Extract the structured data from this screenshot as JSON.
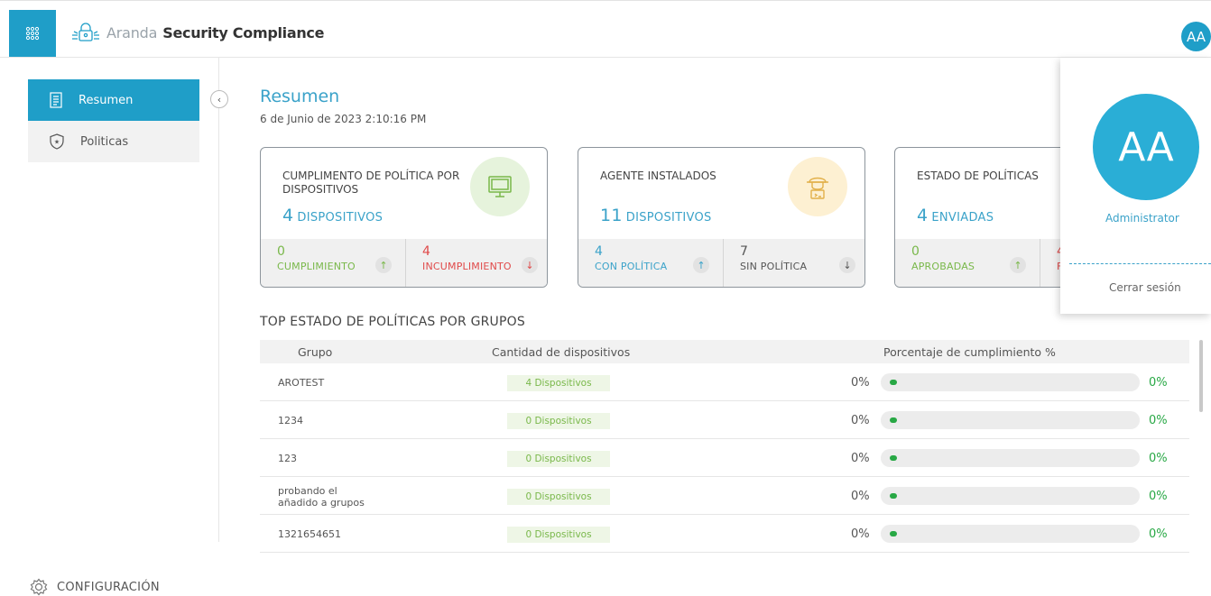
{
  "header": {
    "app_name_light": "Aranda",
    "app_name_bold": "Security Compliance",
    "avatar_initials": "AA",
    "icons": [
      "apps-grid-icon",
      "aranda-logo-icon"
    ],
    "accent": "#1f9ec8"
  },
  "sidebar": {
    "items": [
      {
        "label": "Resumen",
        "icon": "document-icon",
        "active": true
      },
      {
        "label": "Politicas",
        "icon": "shield-star-icon",
        "active": false
      }
    ],
    "config_label": "CONFIGURACIÓN"
  },
  "page": {
    "title": "Resumen",
    "date": "6 de Junio de 2023 2:10:16 PM"
  },
  "cards": [
    {
      "title": "CUMPLIMENTO DE POLÍTICA POR DISPOSITIVOS",
      "value": "4",
      "unit": "DISPOSITIVOS",
      "icon": "monitor-icon",
      "left": {
        "value": "0",
        "label": "CUMPLIMIENTO"
      },
      "right": {
        "value": "4",
        "label": "INCUMPLIMIENTO"
      }
    },
    {
      "title": "AGENTE INSTALADOS",
      "value": "11",
      "unit": "DISPOSITIVOS",
      "icon": "agent-icon",
      "left": {
        "value": "4",
        "label": "CON POLÍTICA"
      },
      "right": {
        "value": "7",
        "label": "SIN POLÍTICA"
      }
    },
    {
      "title": "ESTADO DE POLÍTICAS",
      "value": "4",
      "unit": "ENVIADAS",
      "icon": "policy-icon",
      "left": {
        "value": "0",
        "label": "APROBADAS"
      },
      "right": {
        "value": "4",
        "label": "FA"
      }
    }
  ],
  "table": {
    "title": "TOP ESTADO DE POLÍTICAS POR GRUPOS",
    "headers": [
      "Grupo",
      "Cantidad de dispositivos",
      "Porcentaje de cumplimiento %"
    ],
    "rows": [
      {
        "group": "AROTEST",
        "devices": "4 Dispositivos",
        "pct": "0%",
        "pct_end": "0%",
        "fill": 0
      },
      {
        "group": "1234",
        "devices": "0 Dispositivos",
        "pct": "0%",
        "pct_end": "0%",
        "fill": 0
      },
      {
        "group": "123",
        "devices": "0 Dispositivos",
        "pct": "0%",
        "pct_end": "0%",
        "fill": 0
      },
      {
        "group": "probando el\nañadido a grupos",
        "devices": "0 Dispositivos",
        "pct": "0%",
        "pct_end": "0%",
        "fill": 0
      },
      {
        "group": "1321654651",
        "devices": "0 Dispositivos",
        "pct": "0%",
        "pct_end": "0%",
        "fill": 0
      }
    ]
  },
  "user_menu": {
    "initials": "AA",
    "name": "Administrator",
    "logout": "Cerrar sesión"
  }
}
